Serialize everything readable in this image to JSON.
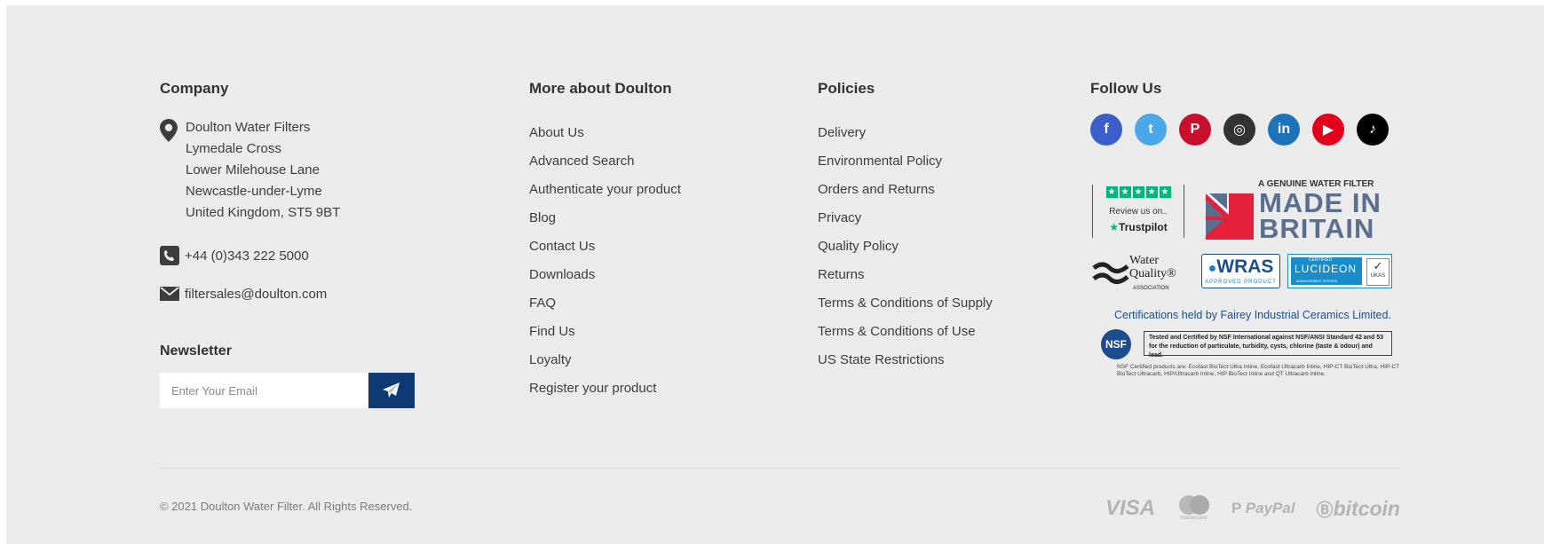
{
  "company": {
    "heading": "Company",
    "address_lines": [
      "Doulton Water Filters",
      "Lymedale Cross",
      "Lower Milehouse Lane",
      "Newcastle-under-Lyme",
      "United Kingdom, ST5 9BT"
    ],
    "phone": "+44 (0)343 222 5000",
    "email": "filtersales@doulton.com"
  },
  "newsletter": {
    "heading": "Newsletter",
    "placeholder": "Enter Your Email",
    "value": ""
  },
  "more_about": {
    "heading": "More about Doulton",
    "links": [
      "About Us",
      "Advanced Search",
      "Authenticate your product",
      "Blog",
      "Contact Us",
      "Downloads",
      "FAQ",
      "Find Us",
      "Loyalty",
      "Register your product"
    ]
  },
  "policies": {
    "heading": "Policies",
    "links": [
      "Delivery",
      "Environmental Policy",
      "Orders and Returns",
      "Privacy",
      "Quality Policy",
      "Returns",
      "Terms & Conditions of Supply",
      "Terms & Conditions of Use",
      "US State Restrictions"
    ]
  },
  "follow": {
    "heading": "Follow Us",
    "socials": [
      {
        "name": "facebook-icon",
        "glyph": "f",
        "color": "#3b5ec9"
      },
      {
        "name": "twitter-icon",
        "glyph": "t",
        "color": "#4aa8e8"
      },
      {
        "name": "pinterest-icon",
        "glyph": "P",
        "color": "#c8102e"
      },
      {
        "name": "instagram-icon",
        "glyph": "◎",
        "color": "#333333"
      },
      {
        "name": "linkedin-icon",
        "glyph": "in",
        "color": "#1c73b9"
      },
      {
        "name": "youtube-icon",
        "glyph": "▶",
        "color": "#e3001b"
      },
      {
        "name": "tiktok-icon",
        "glyph": "♪",
        "color": "#000000"
      }
    ],
    "trustpilot": {
      "review": "Review us on..",
      "logo": "Trustpilot"
    },
    "made_in_britain": {
      "tagline": "A GENUINE WATER FILTER",
      "line1": "MADE IN",
      "line2": "BRITAIN"
    },
    "wqa": {
      "line1": "Water",
      "line2": "Quality",
      "mark": "®",
      "assoc": "ASSOCIATION"
    },
    "wras": {
      "main": "WRAS",
      "sub": "APPROVED PRODUCT"
    },
    "lucideon": {
      "certified": "CERTIFIED",
      "name": "LUCIDEON",
      "sub": "MANAGEMENT SYSTEM",
      "badge": "UKAS"
    },
    "cert_note": "Certifications held by Fairey Industrial Ceramics Limited.",
    "nsf": {
      "logo": "NSF",
      "statement": "Tested and Certified by NSF International against NSF/ANSI Standard 42 and 53 for the reduction of particulate, turbidity, cysts, chlorine (taste & odour) and lead.",
      "fine_print": "NSF Certified products are: Ecofast BioTect Ultra Inline, Ecofast Ultracarb Inline, HIP-CT BioTect Ultra, HIP-CT BioTect Ultracarb, HIP/Ultracarb Inline, HIP BioTect Inline and QT Ultracarb Inline."
    }
  },
  "bottom": {
    "copyright": "© 2021 Doulton Water Filter. All Rights Reserved.",
    "payments": {
      "visa": "VISA",
      "mastercard": "mastercard",
      "paypal": "PayPal",
      "bitcoin": "bitcoin"
    }
  },
  "colors": {
    "background": "#ebebeb",
    "accent": "#0d3a72",
    "link_text": "#3d3d3d"
  }
}
